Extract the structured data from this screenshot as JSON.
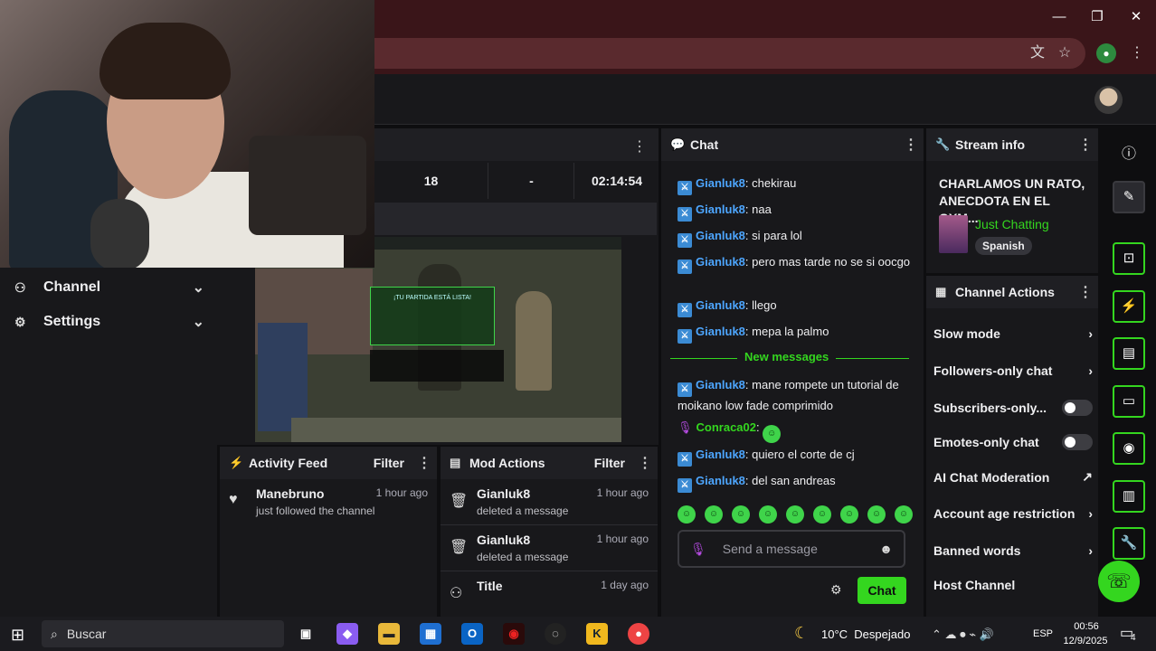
{
  "browser": {
    "translate_icon": "translate-icon",
    "star_icon": "star-icon",
    "profile_icon": "profile-icon"
  },
  "sidebar": {
    "items": [
      {
        "label": "Channel"
      },
      {
        "label": "Settings"
      }
    ]
  },
  "stats": {
    "viewers": "18",
    "followers": "-",
    "time": "02:14:54"
  },
  "preview": {
    "banner": "¡TU PARTIDA ESTÁ LISTA!"
  },
  "activity": {
    "title": "Activity Feed",
    "filter": "Filter",
    "items": [
      {
        "name": "Manebruno",
        "time": "1 hour ago",
        "sub": "just followed the channel"
      }
    ]
  },
  "mod": {
    "title": "Mod Actions",
    "filter": "Filter",
    "items": [
      {
        "name": "Gianluk8",
        "time": "1 hour ago",
        "sub": "deleted a message"
      },
      {
        "name": "Gianluk8",
        "time": "1 hour ago",
        "sub": "deleted a message"
      },
      {
        "name": "Title",
        "time": "1 day ago",
        "sub": ""
      }
    ]
  },
  "chat": {
    "title": "Chat",
    "messages": [
      {
        "user": "Gianluk8",
        "text": "chekirau"
      },
      {
        "user": "Gianluk8",
        "text": "naa"
      },
      {
        "user": "Gianluk8",
        "text": "si para lol"
      },
      {
        "user": "Gianluk8",
        "text": "pero mas tarde no se si oocgo"
      },
      {
        "user": "Gianluk8",
        "text": "llego"
      },
      {
        "user": "Gianluk8",
        "text": "mepa la palmo"
      }
    ],
    "new_messages": "New messages",
    "messages2": [
      {
        "user": "Gianluk8",
        "text": "mane rompete un tutorial de moikano low fade comprimido"
      },
      {
        "user": "Conraca02",
        "text": ""
      },
      {
        "user": "Gianluk8",
        "text": "quiero el corte de cj"
      },
      {
        "user": "Gianluk8",
        "text": "del san andreas"
      }
    ],
    "placeholder": "Send a message",
    "send": "Chat"
  },
  "stream_info": {
    "title": "Stream info",
    "stream_title": "CHARLAMOS UN RATO, ANECDOTA EN EL GYM...",
    "category": "Just Chatting",
    "language": "Spanish"
  },
  "channel_actions": {
    "title": "Channel Actions",
    "items": [
      {
        "label": "Slow mode",
        "kind": "chevron"
      },
      {
        "label": "Followers-only chat",
        "kind": "chevron"
      },
      {
        "label": "Subscribers-only...",
        "kind": "toggle"
      },
      {
        "label": "Emotes-only chat",
        "kind": "toggle"
      },
      {
        "label": "AI Chat Moderation",
        "kind": "external"
      },
      {
        "label": "Account age restriction",
        "kind": "chevron"
      },
      {
        "label": "Banned words",
        "kind": "chevron"
      },
      {
        "label": "Host Channel",
        "kind": "none"
      }
    ]
  },
  "taskbar": {
    "search": "Buscar",
    "weather": "10°C  Despejado",
    "lang": "ESP",
    "time": "00:56",
    "date": "12/9/2025",
    "notif": "4"
  },
  "colors": {
    "accent": "#34d61f",
    "username": "#4da6ff",
    "titlebar": "#3a1519"
  }
}
